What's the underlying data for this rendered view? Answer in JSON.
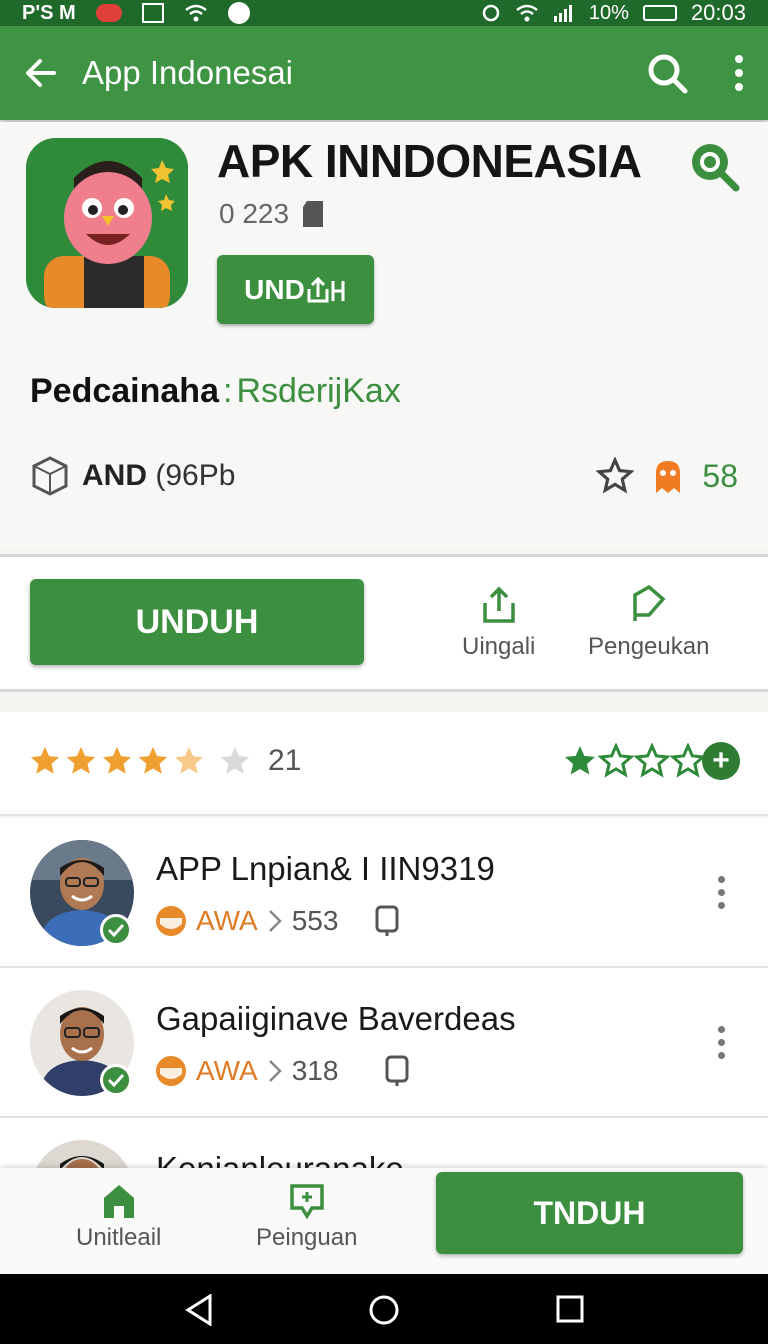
{
  "status_bar": {
    "left_text": "P'S M",
    "battery_text": "10%",
    "time": "20:03"
  },
  "app_bar": {
    "title": "App Indonesai"
  },
  "app": {
    "title": "APK INNDONEASIA",
    "meta": "0 223",
    "install_label": "UND",
    "developer_label": "Pedcainaha",
    "developer_sep": ":",
    "developer_value": "RsderijKax",
    "size_bold": "AND",
    "size_rest": "(96Pb",
    "badge_count": "58"
  },
  "actions": {
    "download_label": "UNDUH",
    "share_label": "Uingali",
    "report_label": "Pengeukan"
  },
  "rating": {
    "stars": 4.5,
    "count": "21",
    "user_stars": 1
  },
  "list": [
    {
      "name": "APP Lnpian& I IIN9319",
      "tag": "AWA",
      "count": "553"
    },
    {
      "name": "Gapaiiginave Baverdeas",
      "tag": "AWA",
      "count": "318"
    },
    {
      "name": "Kenianleuranake"
    }
  ],
  "bottom_nav": {
    "home_label": "Unitleail",
    "reviews_label": "Peinguan",
    "download_label": "TNDUH"
  },
  "colors": {
    "brand_green": "#3b8f3f",
    "dark_green": "#1f6a2b",
    "accent_orange": "#e07b25",
    "star_orange": "#f0a030"
  }
}
